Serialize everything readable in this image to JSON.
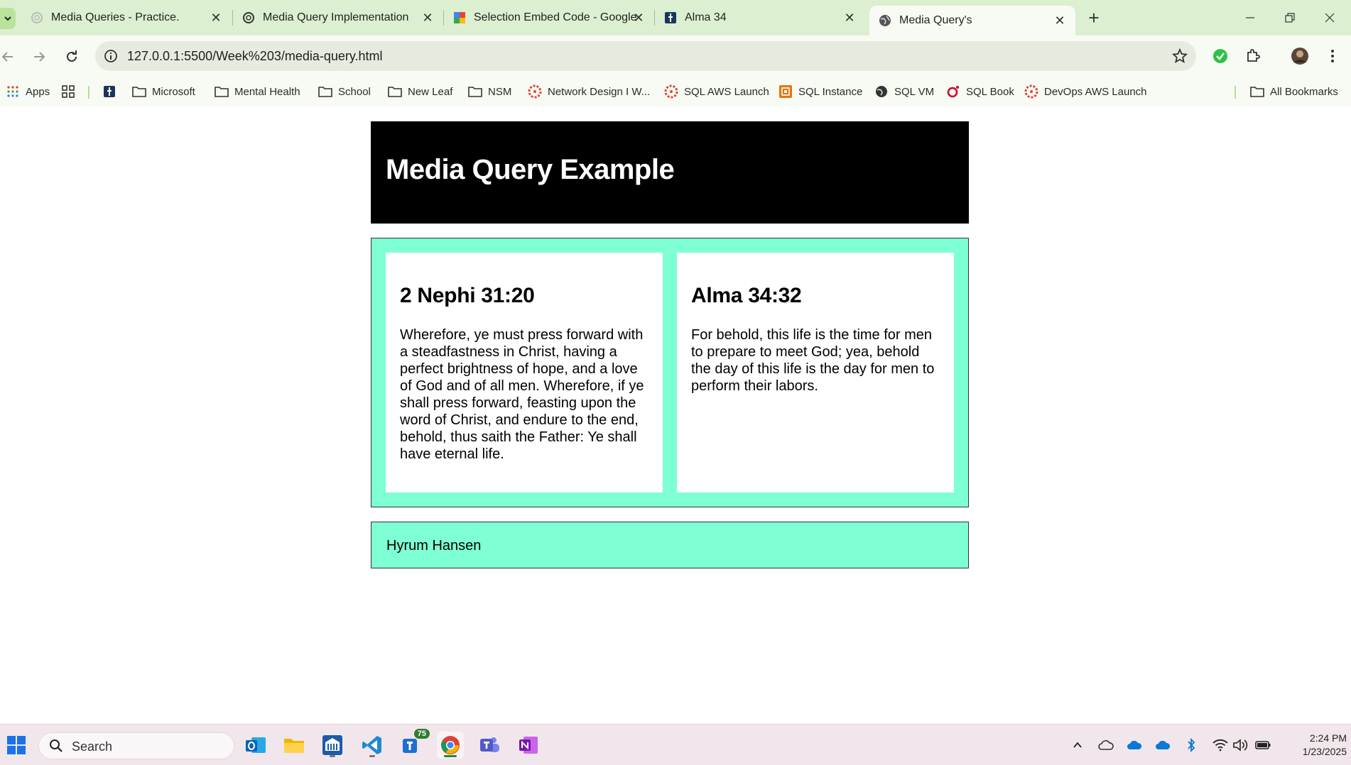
{
  "browser": {
    "tabs": [
      {
        "title": "Media Queries - Practice.",
        "icon": "openai-icon"
      },
      {
        "title": "Media Query Implementation",
        "icon": "openai-icon"
      },
      {
        "title": "Selection Embed Code - Google",
        "icon": "google-sites-icon"
      },
      {
        "title": "Alma 34",
        "icon": "church-icon"
      },
      {
        "title": "Media Query's",
        "icon": "globe-icon",
        "active": true
      }
    ],
    "address": "127.0.0.1:5500/Week%203/media-query.html",
    "bookmarks": [
      {
        "label": "Apps",
        "icon": "apps-grid-icon"
      },
      {
        "label": "",
        "icon": "tab-groups-icon"
      },
      {
        "label": "",
        "icon": "church-icon"
      },
      {
        "label": "Microsoft",
        "icon": "folder-icon"
      },
      {
        "label": "Mental Health",
        "icon": "folder-icon"
      },
      {
        "label": "School",
        "icon": "folder-icon"
      },
      {
        "label": "New Leaf",
        "icon": "folder-icon"
      },
      {
        "label": "NSM",
        "icon": "folder-icon"
      },
      {
        "label": "Network Design I W...",
        "icon": "instructure-icon"
      },
      {
        "label": "SQL AWS Launch",
        "icon": "instructure-icon"
      },
      {
        "label": "SQL Instance",
        "icon": "aws-icon"
      },
      {
        "label": "SQL VM",
        "icon": "globe-dark-icon"
      },
      {
        "label": "SQL Book",
        "icon": "oreilly-icon"
      },
      {
        "label": "DevOps AWS Launch",
        "icon": "instructure-icon"
      },
      {
        "label": "All Bookmarks",
        "icon": "folder-icon"
      }
    ]
  },
  "page": {
    "header_title": "Media Query Example",
    "cards": [
      {
        "title": "2 Nephi 31:20",
        "text": "Wherefore, ye must press forward with a steadfastness in Christ, having a perfect brightness of hope, and a love of God and of all men. Wherefore, if ye shall press forward, feasting upon the word of Christ, and endure to the end, behold, thus saith the Father: Ye shall have eternal life."
      },
      {
        "title": "Alma 34:32",
        "text": "For behold, this life is the time for men to prepare to meet God; yea, behold the day of this life is the day for men to perform their labors."
      }
    ],
    "footer": "Hyrum Hansen",
    "colors": {
      "header_bg": "#000000",
      "panel_bg": "#7fffd4"
    }
  },
  "taskbar": {
    "search_placeholder": "Search",
    "teams_badge": "75",
    "time": "2:24 PM",
    "date": "1/23/2025"
  }
}
